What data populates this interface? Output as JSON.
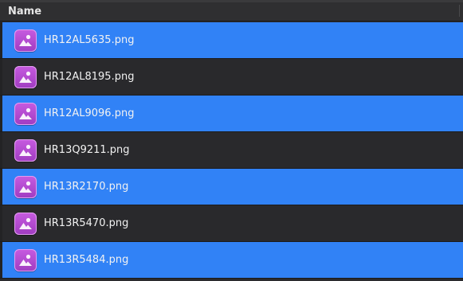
{
  "header": {
    "name_column": "Name"
  },
  "colors": {
    "selected_row": "#3182f6",
    "unselected_row": "#29292c",
    "icon_purple": "#b64ad3"
  },
  "files": [
    {
      "name": "HR12AL5635.png",
      "selected": true,
      "icon": "image-file-icon"
    },
    {
      "name": "HR12AL8195.png",
      "selected": false,
      "icon": "image-file-icon"
    },
    {
      "name": "HR12AL9096.png",
      "selected": true,
      "icon": "image-file-icon"
    },
    {
      "name": "HR13Q9211.png",
      "selected": false,
      "icon": "image-file-icon"
    },
    {
      "name": "HR13R2170.png",
      "selected": true,
      "icon": "image-file-icon"
    },
    {
      "name": "HR13R5470.png",
      "selected": false,
      "icon": "image-file-icon"
    },
    {
      "name": "HR13R5484.png",
      "selected": true,
      "icon": "image-file-icon"
    }
  ]
}
